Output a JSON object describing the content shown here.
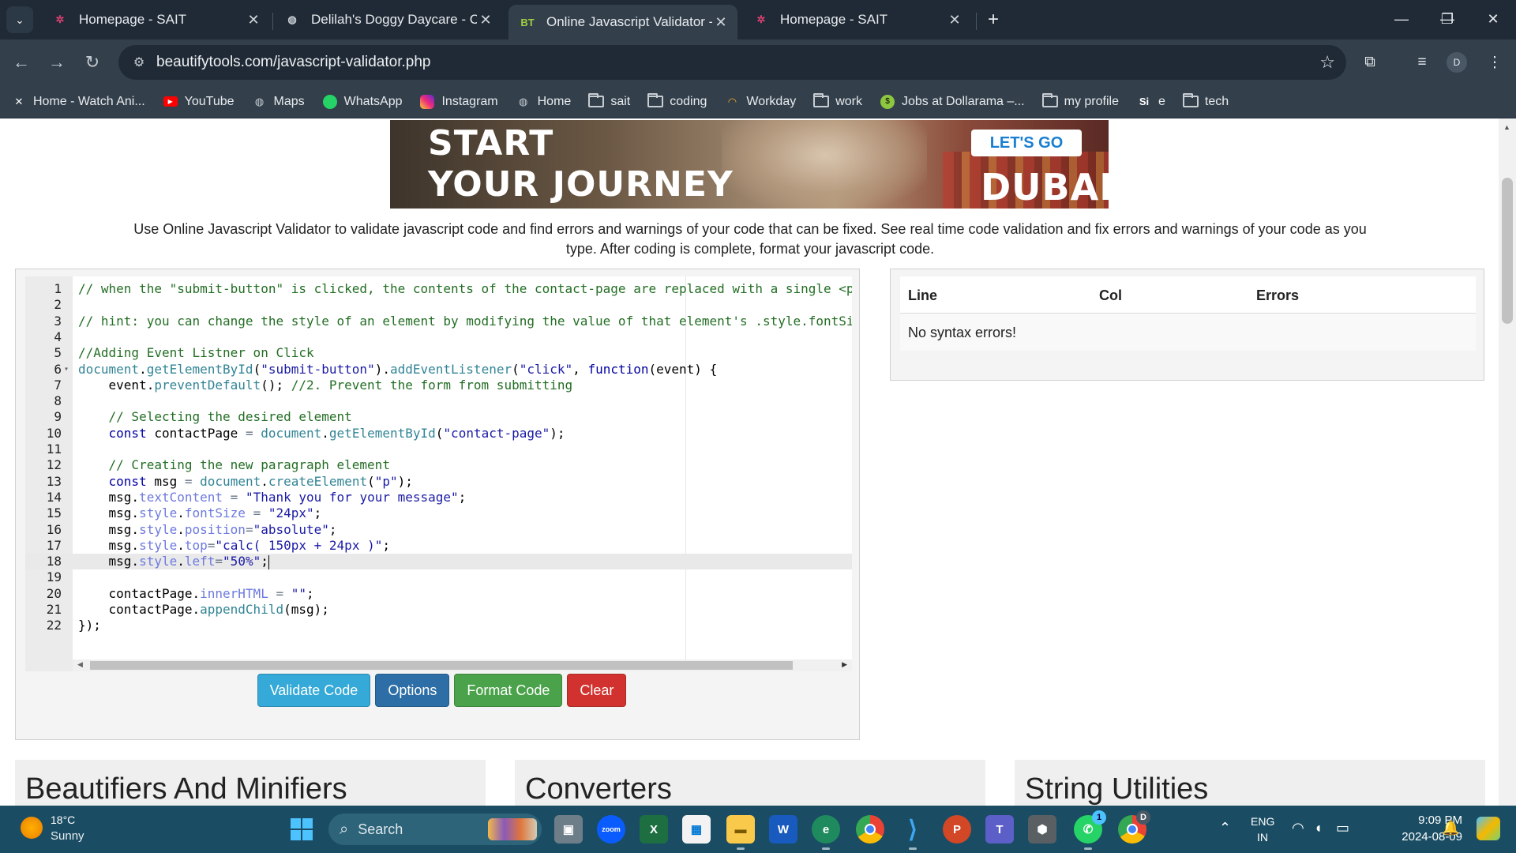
{
  "browser": {
    "tabs": [
      {
        "title": "Homepage - SAIT",
        "favicon": "sait-icon",
        "active": false
      },
      {
        "title": "Delilah's Doggy Daycare - Cont",
        "favicon": "globe-icon",
        "active": false
      },
      {
        "title": "Online Javascript Validator - Bea",
        "favicon": "BT",
        "active": true
      },
      {
        "title": "Homepage - SAIT",
        "favicon": "sait-icon",
        "active": false
      }
    ],
    "url": "beautifytools.com/javascript-validator.php",
    "profile_initial": "D",
    "bookmarks": [
      {
        "label": "Home - Watch Ani...",
        "icon": "x-icon"
      },
      {
        "label": "YouTube",
        "icon": "youtube-icon"
      },
      {
        "label": "Maps",
        "icon": "globe-icon"
      },
      {
        "label": "WhatsApp",
        "icon": "whatsapp-icon"
      },
      {
        "label": "Instagram",
        "icon": "instagram-icon"
      },
      {
        "label": "Home",
        "icon": "globe-icon"
      },
      {
        "label": "sait",
        "icon": "folder-icon"
      },
      {
        "label": "coding",
        "icon": "folder-icon"
      },
      {
        "label": "Workday",
        "icon": "workday-icon"
      },
      {
        "label": "work",
        "icon": "folder-icon"
      },
      {
        "label": "Jobs at Dollarama –...",
        "icon": "dollarama-icon"
      },
      {
        "label": "my profile",
        "icon": "folder-icon"
      },
      {
        "label": "e",
        "icon": "si-icon"
      },
      {
        "label": "tech",
        "icon": "folder-icon"
      }
    ]
  },
  "ad": {
    "headline_line1": "START",
    "headline_line2": "YOUR JOURNEY",
    "cta": "LET'S GO",
    "brand": "DUBAI"
  },
  "description": "Use Online Javascript Validator to validate javascript code and find errors and warnings of your code that can be fixed. See real time code validation and fix errors and warnings of your code as you type. After coding is complete, format your javascript code.",
  "editor": {
    "active_line": 18,
    "lines": [
      "// when the \"submit-button\" is clicked, the contents of the contact-page are replaced with a single <p",
      "",
      "// hint: you can change the style of an element by modifying the value of that element's .style.fontSi",
      "",
      "//Adding Event Listner on Click",
      "document.getElementById(\"submit-button\").addEventListener(\"click\", function(event) {",
      "    event.preventDefault(); //2. Prevent the form from submitting",
      "",
      "    // Selecting the desired element",
      "    const contactPage = document.getElementById(\"contact-page\");",
      "",
      "    // Creating the new paragraph element",
      "    const msg = document.createElement(\"p\");",
      "    msg.textContent = \"Thank you for your message\";",
      "    msg.style.fontSize = \"24px\";",
      "    msg.style.position=\"absolute\";",
      "    msg.style.top=\"calc( 150px + 24px )\";",
      "    msg.style.left=\"50%\";",
      "",
      "    contactPage.innerHTML = \"\";",
      "    contactPage.appendChild(msg);",
      "});"
    ]
  },
  "buttons": {
    "validate": "Validate Code",
    "options": "Options",
    "format": "Format Code",
    "clear": "Clear"
  },
  "results": {
    "headers": [
      "Line",
      "Col",
      "Errors"
    ],
    "message": "No syntax errors!"
  },
  "cards": [
    "Beautifiers And Minifiers",
    "Converters",
    "String Utilities"
  ],
  "taskbar": {
    "weather_temp": "18°C",
    "weather_text": "Sunny",
    "search_placeholder": "Search",
    "lang_line1": "ENG",
    "lang_line2": "IN",
    "time": "9:09 PM",
    "date": "2024-08-09",
    "whatsapp_badge": "1",
    "chrome_profile": "D"
  }
}
